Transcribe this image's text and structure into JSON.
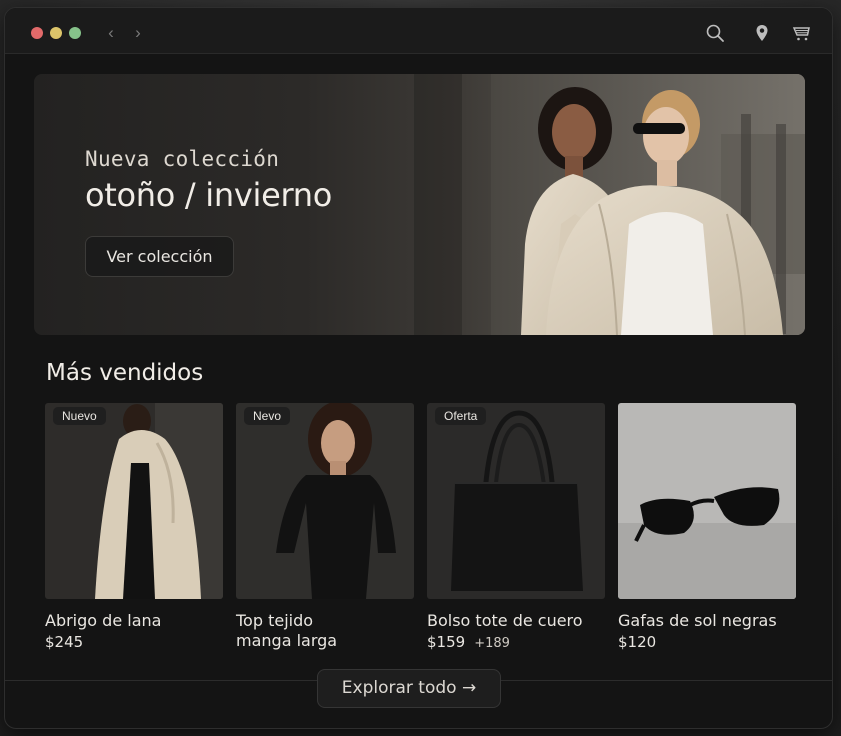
{
  "window": {
    "nav_back": "‹",
    "nav_forward": "›",
    "icons": [
      "search-icon",
      "location-pin-icon",
      "cart-icon"
    ]
  },
  "hero": {
    "kicker": "Nueva colección",
    "title": "otoño / invierno",
    "button_label": "Ver colección"
  },
  "bestsellers": {
    "title": "Más vendidos",
    "products": [
      {
        "badge": "Nuevo",
        "name": "Abrigo de lana",
        "price": "$245",
        "price_alt": ""
      },
      {
        "badge": "Nevo",
        "name": "Top tejido manga larga",
        "price": "",
        "price_alt": ""
      },
      {
        "badge": "Oferta",
        "name": "Bolso tote de cuero",
        "price": "$159",
        "price_alt": "+189"
      },
      {
        "badge": "",
        "name": "Gafas de sol negras",
        "price": "$120",
        "price_alt": ""
      }
    ]
  },
  "footer": {
    "explore_label": "Explorar todo →"
  },
  "colors": {
    "window_bg": "#141414",
    "titlebar_bg": "#1b1b1b",
    "text": "#e9e6e1",
    "traffic_red": "#e26a6a",
    "traffic_yellow": "#dcc46a",
    "traffic_green": "#86c28a"
  }
}
